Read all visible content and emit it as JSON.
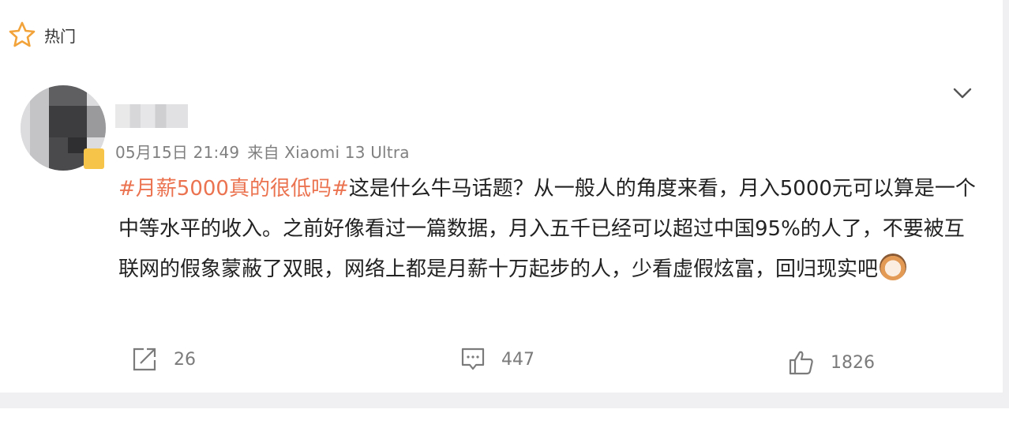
{
  "header": {
    "icon": "star-icon",
    "label": "热门"
  },
  "post": {
    "username": "用户名",
    "date": "05月15日 21:49",
    "source": "来自 Xiaomi 13 Ultra",
    "hashtag": "#月薪5000真的很低吗#",
    "body": "这是什么牛马话题？从一般人的角度来看，月入5000元可以算是一个中等水平的收入。之前好像看过一篇数据，月入五千已经可以超过中国95%的人了，不要被互联网的假象蒙蔽了双眼，网络上都是月薪十万起步的人，少看虚假炫富，回归现实吧",
    "emoji": "cat-face-emoji"
  },
  "actions": {
    "share": {
      "icon": "share-icon",
      "count": "26"
    },
    "comment": {
      "icon": "comment-icon",
      "count": "447"
    },
    "like": {
      "icon": "thumbs-up-icon",
      "count": "1826"
    }
  },
  "colors": {
    "accent": "#eb7350",
    "muted": "#808080"
  }
}
